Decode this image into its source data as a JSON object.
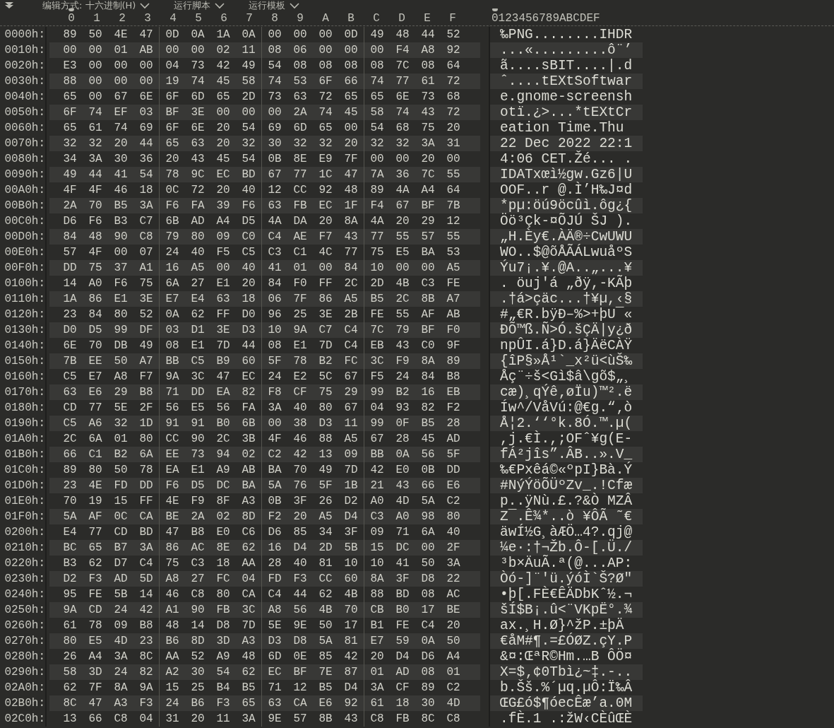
{
  "toolbar": {
    "items": [
      {
        "label": "编辑方式: 十六进制(H)"
      },
      {
        "label": "运行脚本"
      },
      {
        "label": "运行模板"
      }
    ]
  },
  "header": {
    "columns": [
      "0",
      "1",
      "2",
      "3",
      "4",
      "5",
      "6",
      "7",
      "8",
      "9",
      "A",
      "B",
      "C",
      "D",
      "E",
      "F"
    ],
    "ascii": "0123456789ABCDEF"
  },
  "rows": [
    {
      "offset": "0000h:",
      "hex": "89 50 4E 47 0D 0A 1A 0A 00 00 00 0D 49 48 44 52",
      "ascii": "‰PNG........IHDR"
    },
    {
      "offset": "0010h:",
      "hex": "00 00 01 AB 00 00 02 11 08 06 00 00 00 F4 A8 92",
      "ascii": "...«.........ô¨’"
    },
    {
      "offset": "0020h:",
      "hex": "E3 00 00 00 04 73 42 49 54 08 08 08 08 7C 08 64",
      "ascii": "ã....sBIT....|.d"
    },
    {
      "offset": "0030h:",
      "hex": "88 00 00 00 19 74 45 58 74 53 6F 66 74 77 61 72",
      "ascii": "ˆ....tEXtSoftwar"
    },
    {
      "offset": "0040h:",
      "hex": "65 00 67 6E 6F 6D 65 2D 73 63 72 65 65 6E 73 68",
      "ascii": "e.gnome-screensh"
    },
    {
      "offset": "0050h:",
      "hex": "6F 74 EF 03 BF 3E 00 00 00 2A 74 45 58 74 43 72",
      "ascii": "otï.¿>...*tEXtCr"
    },
    {
      "offset": "0060h:",
      "hex": "65 61 74 69 6F 6E 20 54 69 6D 65 00 54 68 75 20",
      "ascii": "eation Time.Thu "
    },
    {
      "offset": "0070h:",
      "hex": "32 32 20 44 65 63 20 32 30 32 32 20 32 32 3A 31",
      "ascii": "22 Dec 2022 22:1"
    },
    {
      "offset": "0080h:",
      "hex": "34 3A 30 36 20 43 45 54 0B 8E E9 7F 00 00 20 00",
      "ascii": "4:06 CET.Žé... ."
    },
    {
      "offset": "0090h:",
      "hex": "49 44 41 54 78 9C EC BD 67 77 1C 47 7A 36 7C 55",
      "ascii": "IDATxœì½gw.Gz6|U"
    },
    {
      "offset": "00A0h:",
      "hex": "4F 4F 46 18 0C 72 20 40 12 CC 92 48 89 4A A4 64",
      "ascii": "OOF..r @.Ì’H‰J¤d"
    },
    {
      "offset": "00B0h:",
      "hex": "2A 70 B5 3A F6 FA 39 F6 63 FB EC 1F F4 67 BF 7B",
      "ascii": "*pµ:öú9öcûì.ôg¿{"
    },
    {
      "offset": "00C0h:",
      "hex": "D6 F6 B3 C7 6B AD A4 D5 4A DA 20 8A 4A 20 29 12",
      "ascii": "Öö³Çk-¤ÕJÚ ŠJ )."
    },
    {
      "offset": "00D0h:",
      "hex": "84 48 90 C8 79 80 09 C0 C4 AE F7 43 77 55 57 55",
      "ascii": "„H.Èy€.ÀÄ®÷CwUWU"
    },
    {
      "offset": "00E0h:",
      "hex": "57 4F 00 07 24 40 F5 C5 C3 C1 4C 77 75 E5 BA 53",
      "ascii": "WO..$@õÅÃÁLwuåºS"
    },
    {
      "offset": "00F0h:",
      "hex": "DD 75 37 A1 16 A5 00 40 41 01 00 84 10 00 00 A5",
      "ascii": "Ýu7¡.¥.@A..„...¥"
    },
    {
      "offset": "0100h:",
      "hex": "14 A0 F6 75 6A 27 E1 20 84 F0 FF 2C 2D 4B C3 FE",
      "ascii": ". öuj'á „ðÿ,-KÃþ"
    },
    {
      "offset": "0110h:",
      "hex": "1A 86 E1 3E E7 E4 63 18 06 7F 86 A5 B5 2C 8B A7",
      "ascii": ".†á>çäc...†¥µ,‹§"
    },
    {
      "offset": "0120h:",
      "hex": "23 84 80 52 0A 62 FF D0 96 25 3E 2B FE 55 AF AB",
      "ascii": "#„€R.bÿÐ–%>+þU¯«"
    },
    {
      "offset": "0130h:",
      "hex": "D0 D5 99 DF 03 D1 3E D3 10 9A C7 C4 7C 79 BF F0",
      "ascii": "ÐÕ™ß.Ñ>Ó.šÇÄ|y¿ð"
    },
    {
      "offset": "0140h:",
      "hex": "6E 70 DB 49 08 E1 7D 44 08 E1 7D C4 EB 43 C0 9F",
      "ascii": "npÛI.á}D.á}ÄëCÀŸ"
    },
    {
      "offset": "0150h:",
      "hex": "7B EE 50 A7 BB C5 B9 60 5F 78 B2 FC 3C F9 8A 89",
      "ascii": "{îP§»Å¹`_x²ü<ùŠ‰"
    },
    {
      "offset": "0160h:",
      "hex": "C5 E7 A8 F7 9A 3C 47 EC 24 E2 5C 67 F5 24 84 B8",
      "ascii": "Åç¨÷š<Gì$â\\gõ$„¸"
    },
    {
      "offset": "0170h:",
      "hex": "63 E6 29 B8 71 DD EA 82 F8 CF 75 29 99 B2 16 EB",
      "ascii": "cæ)¸qÝê‚øÏu)™².ë"
    },
    {
      "offset": "0180h:",
      "hex": "CD 77 5E 2F 56 E5 56 FA 3A 40 80 67 04 93 82 F2",
      "ascii": "Íw^/VåVú:@€g.“‚ò"
    },
    {
      "offset": "0190h:",
      "hex": "C5 A6 32 1D 91 91 B0 6B 00 38 D3 11 99 0F B5 28",
      "ascii": "Å¦2.‘‘°k.8Ó.™.µ("
    },
    {
      "offset": "01A0h:",
      "hex": "2C 6A 01 80 CC 90 2C 3B 4F 46 88 A5 67 28 45 AD",
      "ascii": ",j.€Ì.,;OFˆ¥g(E-"
    },
    {
      "offset": "01B0h:",
      "hex": "66 C1 B2 6A EE 73 94 02 C2 42 13 09 BB 0A 56 5F",
      "ascii": "fÁ²jîs”.ÂB..».V_"
    },
    {
      "offset": "01C0h:",
      "hex": "89 80 50 78 EA E1 A9 AB BA 70 49 7D 42 E0 0B DD",
      "ascii": "‰€Pxêá©«ºpI}Bà.Ý"
    },
    {
      "offset": "01D0h:",
      "hex": "23 4E FD DD F6 D5 DC BA 5A 76 5F 1B 21 43 66 E6",
      "ascii": "#NýÝöÕÜºZv_.!Cfæ"
    },
    {
      "offset": "01E0h:",
      "hex": "70 19 15 FF 4E F9 8F A3 0B 3F 26 D2 A0 4D 5A C2",
      "ascii": "p..ÿNù.£.?&Ò MZÂ"
    },
    {
      "offset": "01F0h:",
      "hex": "5A AF 0C CA BE 2A 02 8D F2 20 A5 D4 C3 A0 98 80",
      "ascii": "Z¯.Ê¾*..ò ¥ÔÃ ˜€"
    },
    {
      "offset": "0200h:",
      "hex": "E4 77 CD BD 47 B8 E0 C6 D6 85 34 3F 09 71 6A 40",
      "ascii": "äwÍ½G¸àÆÖ…4?.qj@"
    },
    {
      "offset": "0210h:",
      "hex": "BC 65 B7 3A 86 AC 8E 62 16 D4 2D 5B 15 DC 00 2F",
      "ascii": "¼e·:†¬Žb.Ô-[.Ü./"
    },
    {
      "offset": "0220h:",
      "hex": "B3 62 D7 C4 75 C3 18 AA 28 40 81 10 10 41 50 3A",
      "ascii": "³b×ÄuÃ.ª(@...AP:"
    },
    {
      "offset": "0230h:",
      "hex": "D2 F3 AD 5D A8 27 FC 04 FD F3 CC 60 8A 3F D8 22",
      "ascii": "Òó-]¨'ü.ýóÌ`Š?Ø\""
    },
    {
      "offset": "0240h:",
      "hex": "95 FE 5B 14 46 C8 80 CA C4 44 62 4B 88 BD 08 AC",
      "ascii": "•þ[.FÈ€ÊÄDbKˆ½.¬"
    },
    {
      "offset": "0250h:",
      "hex": "9A CD 24 42 A1 90 FB 3C A8 56 4B 70 CB B0 17 BE",
      "ascii": "šÍ$B¡.û<¨VKpË°.¾"
    },
    {
      "offset": "0260h:",
      "hex": "61 78 09 B8 48 14 D8 7D 5E 9E 50 17 B1 FE C4 20",
      "ascii": "ax.¸H.Ø}^žP.±þÄ "
    },
    {
      "offset": "0270h:",
      "hex": "80 E5 4D 23 B6 8D 3D A3 D3 D8 5A 81 E7 59 0A 50",
      "ascii": "€åM#¶.=£ÓØZ.çY.P"
    },
    {
      "offset": "0280h:",
      "hex": "26 A4 3A 8C AA 52 A9 48 6D 0E 85 42 20 D4 D6 A4",
      "ascii": "&¤:ŒªR©Hm.…B ÔÖ¤"
    },
    {
      "offset": "0290h:",
      "hex": "58 3D 24 82 A2 30 54 62 EC BF 7E 87 01 AD 08 01",
      "ascii": "X=$‚¢0Tbì¿~‡.-.."
    },
    {
      "offset": "02A0h:",
      "hex": "62 7F 8A 9A 15 25 B4 B5 71 12 B5 D4 3A CF 89 C2",
      "ascii": "b.Šš.%´µq.µÔ:Ï‰Â"
    },
    {
      "offset": "02B0h:",
      "hex": "8C 47 A3 F3 24 B6 F3 65 63 CA E6 92 61 18 30 4D",
      "ascii": "ŒG£ó$¶óecÊæ’a.0M"
    },
    {
      "offset": "02C0h:",
      "hex": "13 66 C8 04 31 20 11 3A 9E 57 8B 43 C8 FB 8C C8",
      "ascii": ".fÈ.1 .:žW‹CÈûŒÈ"
    }
  ]
}
